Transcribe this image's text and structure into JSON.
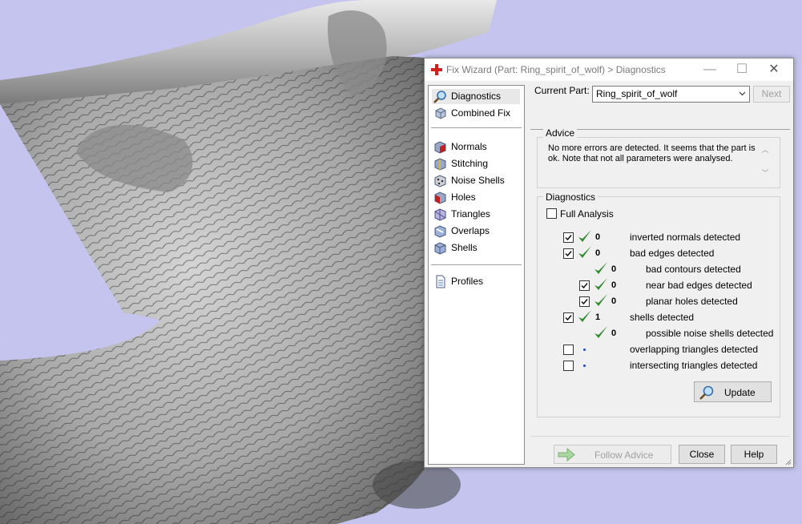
{
  "window": {
    "title": "Fix Wizard (Part: Ring_spirit_of_wolf) > Diagnostics",
    "controls": [
      "—",
      "☐",
      "✕"
    ]
  },
  "sidebar": {
    "items": [
      {
        "label": "Diagnostics",
        "icon": "magnifier-icon",
        "selected": true
      },
      {
        "label": "Combined Fix",
        "icon": "cube-icon"
      },
      {
        "label": "Normals",
        "icon": "normals-cube-icon"
      },
      {
        "label": "Stitching",
        "icon": "stitching-cube-icon"
      },
      {
        "label": "Noise Shells",
        "icon": "noise-shells-icon"
      },
      {
        "label": "Holes",
        "icon": "holes-cube-icon"
      },
      {
        "label": "Triangles",
        "icon": "triangles-icon"
      },
      {
        "label": "Overlaps",
        "icon": "overlaps-icon"
      },
      {
        "label": "Shells",
        "icon": "shells-icon"
      },
      {
        "label": "Profiles",
        "icon": "document-icon"
      }
    ]
  },
  "header": {
    "current_part_label": "Current Part:",
    "current_part_value": "Ring_spirit_of_wolf",
    "next_label": "Next"
  },
  "advice": {
    "label": "Advice",
    "text": "No more errors are detected. It seems that the part is ok. Note that not all parameters were analysed."
  },
  "diagnostics": {
    "label": "Diagnostics",
    "full_analysis_label": "Full Analysis",
    "full_analysis_checked": false,
    "rows": [
      {
        "checkbox": true,
        "checked": true,
        "status": "ok",
        "count": "0",
        "label": "inverted normals detected",
        "indent": 0
      },
      {
        "checkbox": true,
        "checked": true,
        "status": "ok",
        "count": "0",
        "label": "bad edges detected",
        "indent": 0
      },
      {
        "checkbox": false,
        "checked": false,
        "status": "ok",
        "count": "0",
        "label": "bad contours detected",
        "indent": 1
      },
      {
        "checkbox": true,
        "checked": true,
        "status": "ok",
        "count": "0",
        "label": "near bad edges detected",
        "indent": 1
      },
      {
        "checkbox": true,
        "checked": true,
        "status": "ok",
        "count": "0",
        "label": "planar holes detected",
        "indent": 1
      },
      {
        "checkbox": true,
        "checked": true,
        "status": "ok",
        "count": "1",
        "label": "shells detected",
        "indent": 0
      },
      {
        "checkbox": false,
        "checked": false,
        "status": "ok",
        "count": "0",
        "label": "possible noise shells detected",
        "indent": 1
      },
      {
        "checkbox": true,
        "checked": false,
        "status": "pending",
        "count": "",
        "label": "overlapping triangles detected",
        "indent": 0
      },
      {
        "checkbox": true,
        "checked": false,
        "status": "pending",
        "count": "",
        "label": "intersecting triangles detected",
        "indent": 0
      }
    ],
    "update_label": "Update"
  },
  "footer": {
    "follow_advice_label": "Follow Advice",
    "close_label": "Close",
    "help_label": "Help"
  },
  "colors": {
    "viewport_background": "#c4c4ee",
    "check_green": "#2e8b2e",
    "model_gray": "#9a9a9a"
  }
}
